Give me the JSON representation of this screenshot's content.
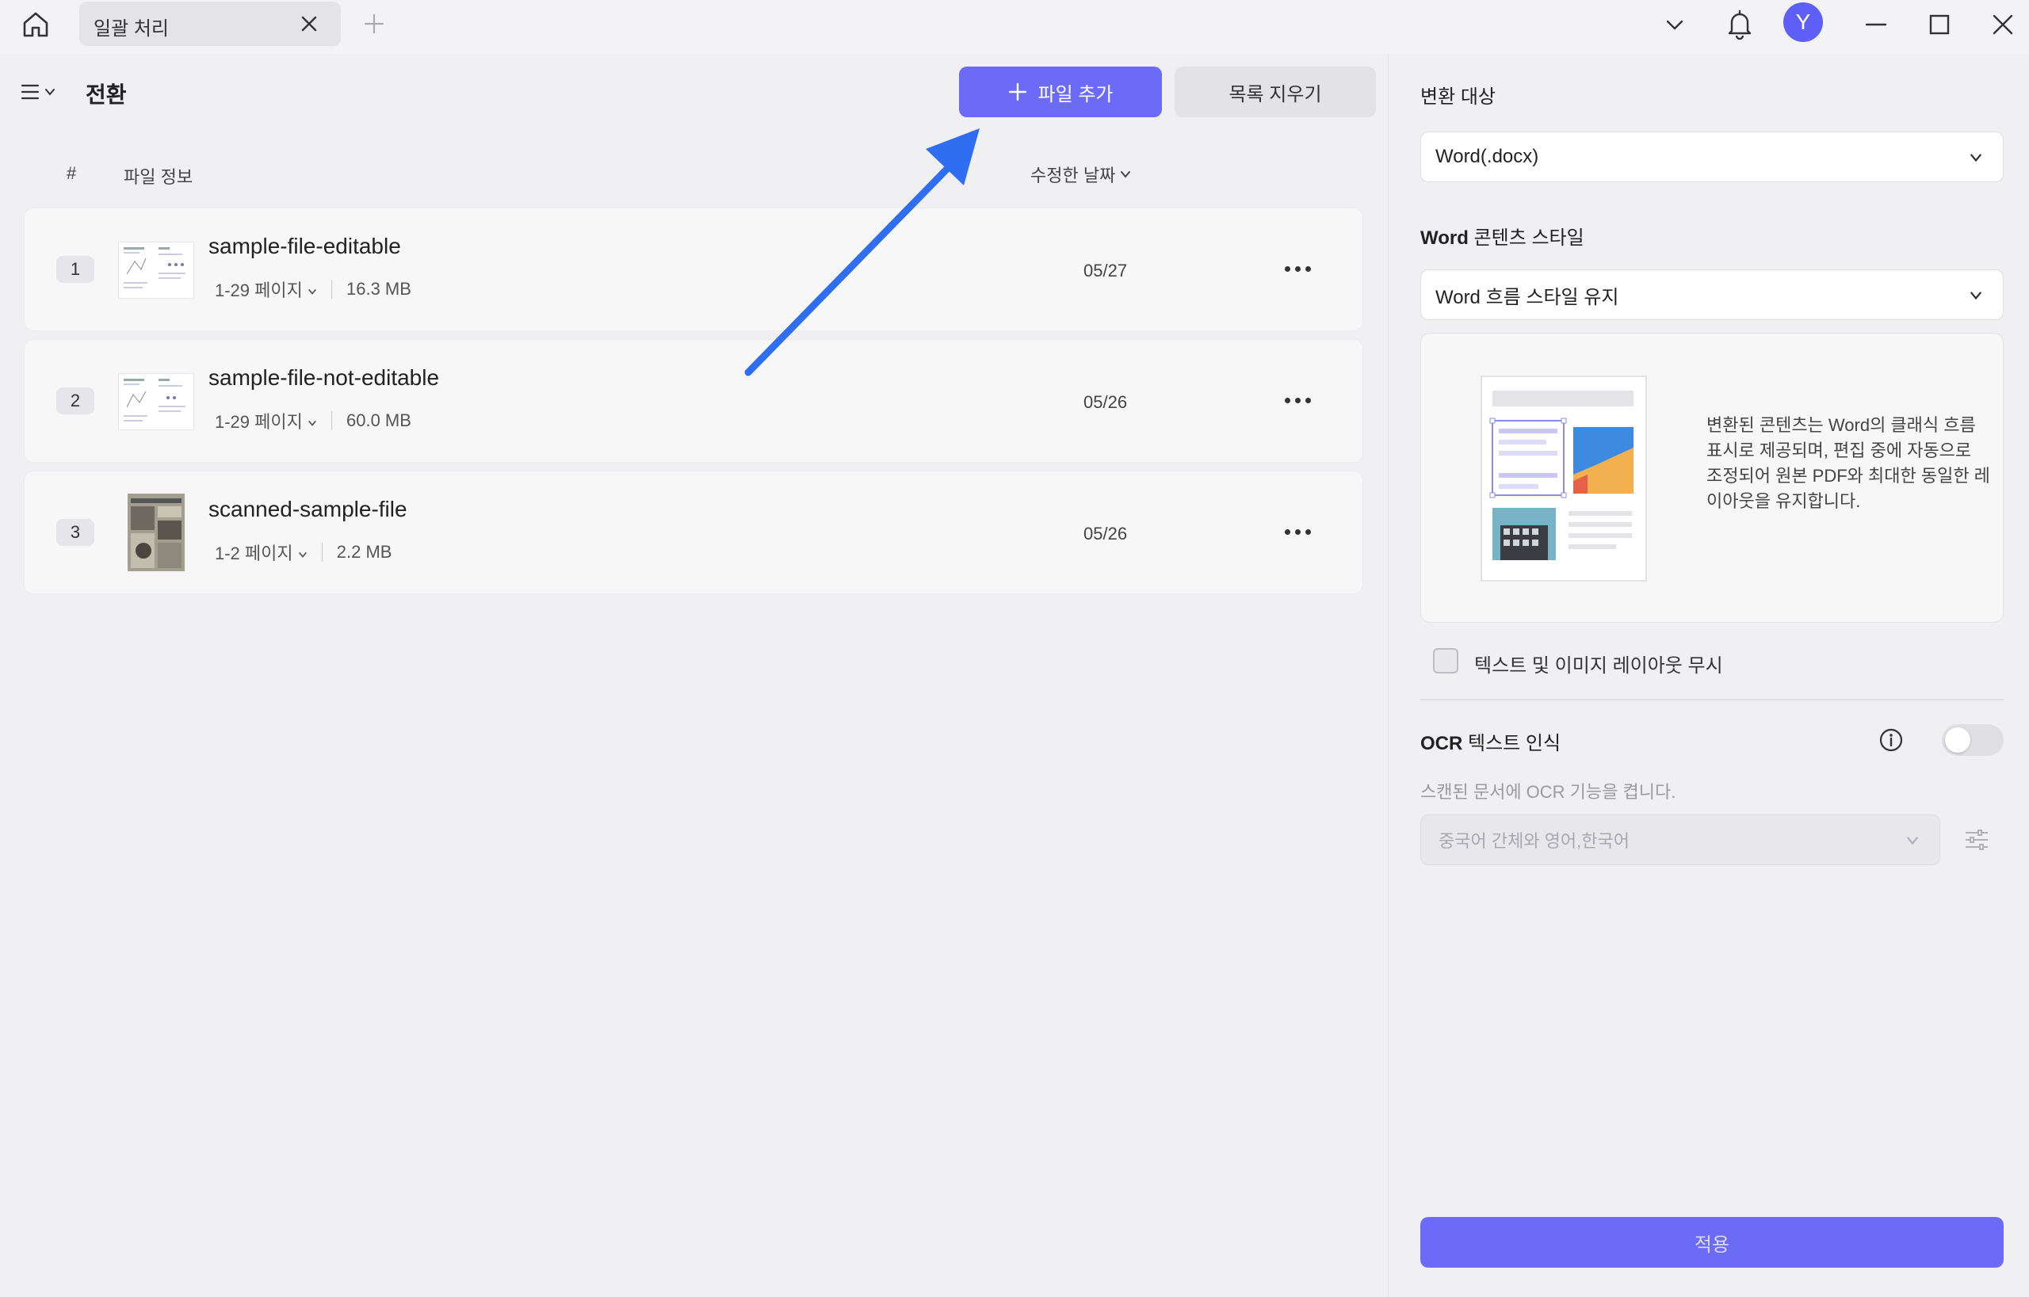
{
  "titlebar": {
    "tab_label": "일괄 처리",
    "avatar_letter": "Y",
    "icons": [
      "home-icon",
      "close-icon",
      "plus-icon",
      "chevron-down-icon",
      "bell-icon",
      "minimize-icon",
      "maximize-icon",
      "close-icon"
    ]
  },
  "left": {
    "section_title": "전환",
    "add_file_label": "파일 추가",
    "clear_list_label": "목록 지우기",
    "columns": {
      "hash": "#",
      "info": "파일 정보",
      "date": "수정한 날짜"
    },
    "files": [
      {
        "num": "1",
        "name": "sample-file-editable",
        "pages": "1-29 페이지",
        "size": "16.3 MB",
        "date": "05/27"
      },
      {
        "num": "2",
        "name": "sample-file-not-editable",
        "pages": "1-29 페이지",
        "size": "60.0 MB",
        "date": "05/26"
      },
      {
        "num": "3",
        "name": "scanned-sample-file",
        "pages": "1-2 페이지",
        "size": "2.2 MB",
        "date": "05/26"
      }
    ]
  },
  "right": {
    "target_label": "변환 대상",
    "target_value": "Word(.docx)",
    "style_label_bold": "Word",
    "style_label_rest": " 콘텐츠 스타일",
    "style_value": "Word 흐름 스타일 유지",
    "preview_desc": "변환된 콘텐츠는 Word의 클래식 흐름 표시로 제공되며, 편집 중에 자동으로 조정되어 원본 PDF와 최대한 동일한 레이아웃을 유지합니다.",
    "ignore_layout_label": "텍스트 및 이미지 레이아웃 무시",
    "ocr_title_bold": "OCR",
    "ocr_title_rest": " 텍스트 인식",
    "ocr_desc": "스캔된 문서에 OCR 기능을 켭니다.",
    "ocr_language": "중국어 간체와 영어,한국어",
    "ocr_enabled": false,
    "apply_label": "적용"
  },
  "colors": {
    "accent": "#6b6bf7",
    "arrow": "#2f6ef0",
    "avatar": "#5d5ff6"
  }
}
